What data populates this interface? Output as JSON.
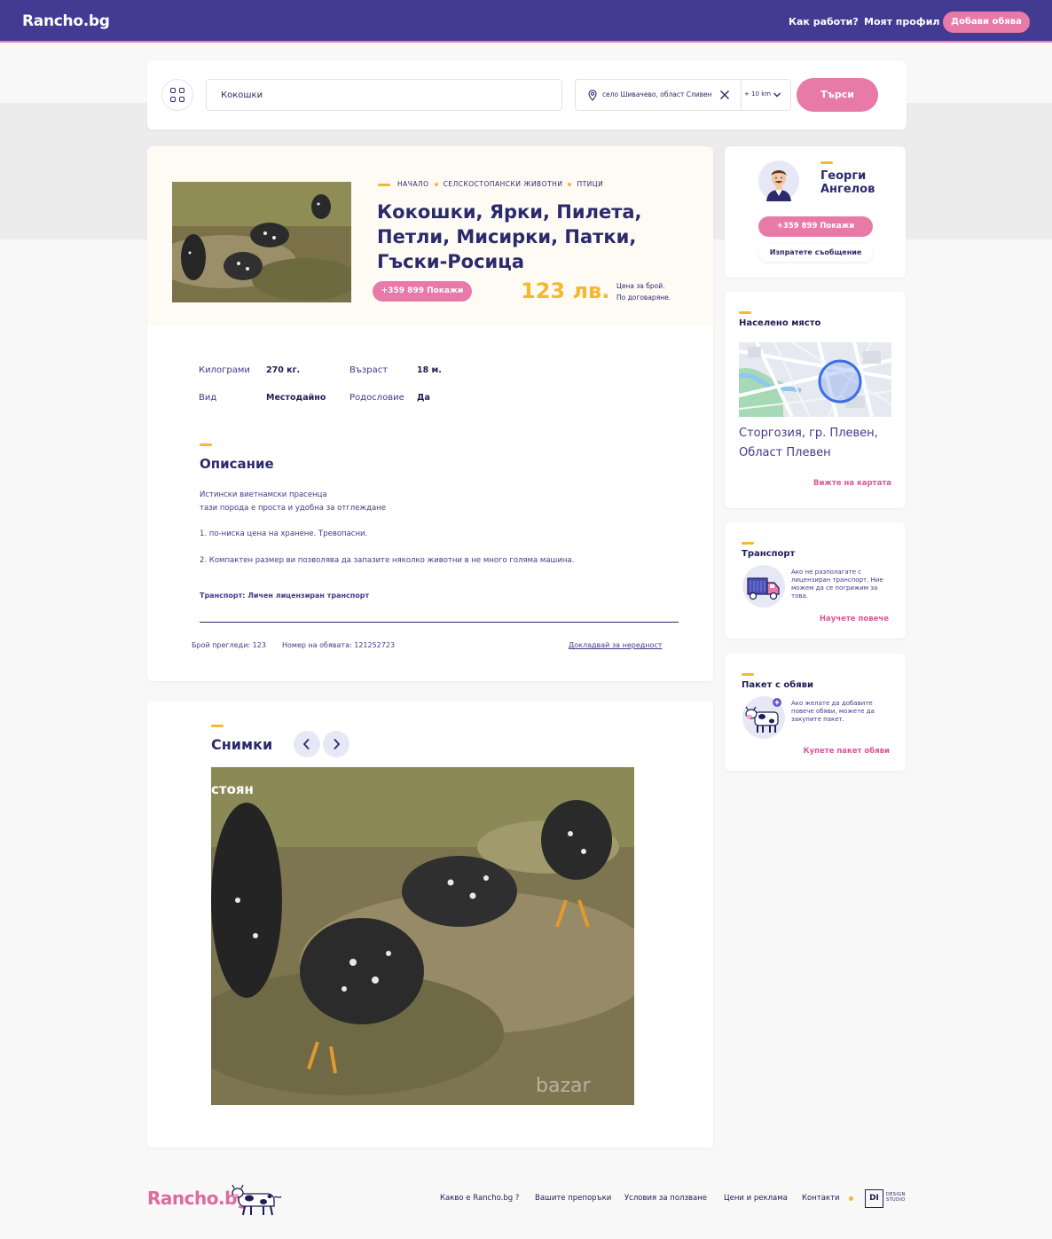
{
  "header": {
    "logo": "Rancho.bg",
    "nav": {
      "how_it_works": "Как работи?",
      "my_profile": "Моят профил"
    },
    "add_listing": "Добави обява"
  },
  "search": {
    "query": "Кокошки",
    "location": "село Шивачево, област Сливен",
    "radius": "+ 10 km",
    "button": "Търси"
  },
  "listing": {
    "breadcrumbs": [
      "НАЧАЛО",
      "СЕЛСКОСТОПАНСКИ ЖИВОТНИ",
      "ПТИЦИ"
    ],
    "title": "Кокошки, Ярки, Пилета, Петли, Мисирки, Патки, Гъски-Росица",
    "phone_button": "+359 899 Покажи",
    "price": "123 лв.",
    "price_note_1": "Цена за брой.",
    "price_note_2": "По договаряне.",
    "attributes": [
      {
        "label": "Килограми",
        "value": "270 кг."
      },
      {
        "label": "Възраст",
        "value": "18 м."
      },
      {
        "label": "Вид",
        "value": "Местодайно"
      },
      {
        "label": "Родословие",
        "value": "Да"
      }
    ],
    "description_title": "Описание",
    "description_lines": [
      "Истински виетнамски прасенца",
      "тази порода е проста и удобна за отглеждане",
      "1. по-ниска цена на хранене. Тревопасни.",
      "2. Компактен размер ви позволява да запазите няколко животни в не много голяма машина."
    ],
    "transport": "Транспорт: Личен лицензиран транспорт",
    "views": "Брой прегледи: 123",
    "listing_number": "Номер на обявата: 121252723",
    "report_link": "Докладвай за нередност"
  },
  "photos": {
    "title": "Снимки",
    "photo_caption": "стоян",
    "photo_watermark": "bazar"
  },
  "seller": {
    "name": "Георги Ангелов",
    "phone_button": "+359 899 Покажи",
    "message_button": "Изпратете съобщение"
  },
  "place": {
    "heading": "Населено място",
    "text": "Сторгозия, гр. Плевен, Област Плевен",
    "link": "Вижте на картата"
  },
  "transport": {
    "heading": "Транспорт",
    "text": "Ако не разполагате с лицензиран транспорт, Ние можем да се погрижим за това.",
    "link": "Научете повече"
  },
  "package": {
    "heading": "Пакет с обяви",
    "text": "Ако желате да добавите повече обяви, можете да закупите пакет.",
    "link": "Купете пакет обяви"
  },
  "footer": {
    "logo": "Rancho.bg",
    "links": [
      "Какво е Rancho.bg ?",
      "Вашите препоръки",
      "Условия за ползване",
      "Цени и реклама",
      "Контакти"
    ],
    "studio_mark": "DI",
    "studio_label_1": "DESIGN",
    "studio_label_2": "STUDIO"
  },
  "colors": {
    "primary": "#433b91",
    "accent_pink": "#e87aa8",
    "accent_yellow": "#f5b830",
    "text_navy": "#2b2a6b"
  }
}
